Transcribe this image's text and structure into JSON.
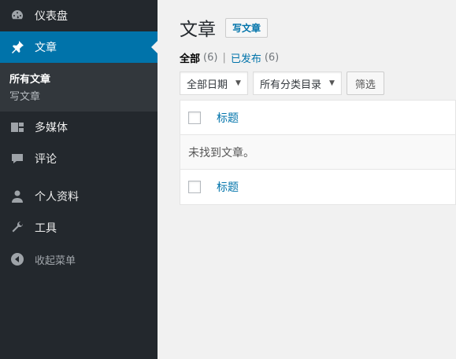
{
  "sidebar": {
    "items": [
      {
        "label": "仪表盘",
        "icon": "dashboard-icon"
      },
      {
        "label": "文章",
        "icon": "pin-icon",
        "active": true
      },
      {
        "label": "多媒体",
        "icon": "media-icon"
      },
      {
        "label": "评论",
        "icon": "comment-icon"
      },
      {
        "label": "个人资料",
        "icon": "user-icon"
      },
      {
        "label": "工具",
        "icon": "wrench-icon"
      },
      {
        "label": "收起菜单",
        "icon": "collapse-icon"
      }
    ],
    "submenu": [
      "所有文章",
      "写文章"
    ]
  },
  "main": {
    "title": "文章",
    "add_new": "写文章",
    "views": {
      "all": "全部",
      "all_count": "(6)",
      "separator": "|",
      "published": "已发布",
      "published_count": "(6)"
    },
    "filters": {
      "date": "全部日期",
      "category": "所有分类目录",
      "submit": "筛选"
    },
    "table": {
      "column_title": "标题",
      "empty_message": "未找到文章。",
      "footer_title": "标题"
    }
  },
  "colors": {
    "sidebar_bg": "#23282d",
    "active_bg": "#0073aa",
    "link": "#0073aa",
    "page_bg": "#f1f1f1"
  }
}
